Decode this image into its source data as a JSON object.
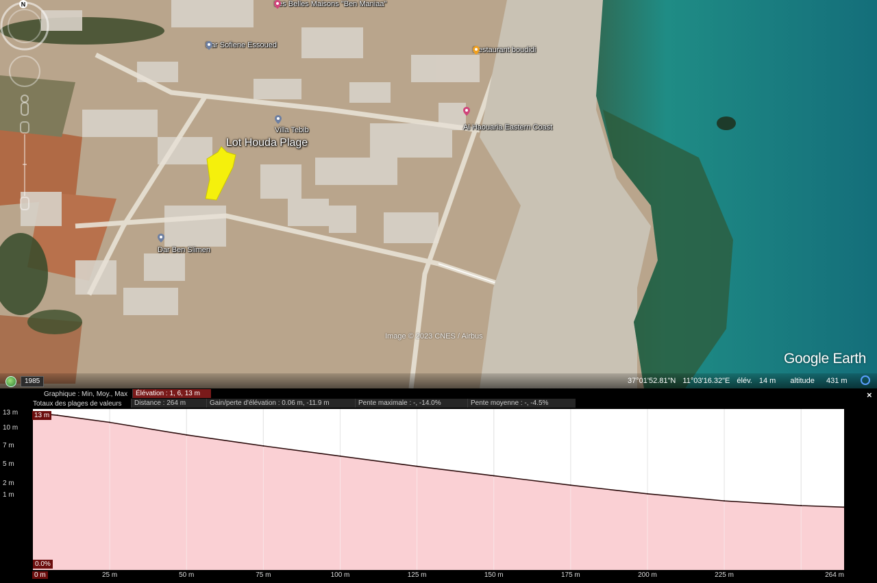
{
  "map": {
    "places": [
      {
        "name": "Les Belles Maisons \"Ben Maniaa\"",
        "pin": "pink"
      },
      {
        "name": "Dar Sofiene Essoued",
        "pin": "gray"
      },
      {
        "name": "Restaurant boudidi",
        "pin": "orange"
      },
      {
        "name": "Villa Tebib",
        "pin": "gray"
      },
      {
        "name": "Al Haouaria Eastern Coast",
        "pin": "pink"
      },
      {
        "name": "Dar Ben Slimen",
        "pin": "gray"
      }
    ],
    "lot_label": "Lot Houda Plage",
    "credit": "Image © 2023 CNES / Airbus",
    "logo": "Google Earth",
    "compass_letter": "N"
  },
  "status": {
    "year": "1985",
    "lat": "37°01'52.81\"N",
    "lon": "11°03'16.32\"E",
    "elev_label": "élév.",
    "elev_value": "14 m",
    "alt_label": "altitude",
    "alt_value": "431 m"
  },
  "profile": {
    "close": "×",
    "graph_label": "Graphique : Min, Moy., Max",
    "elevation_field": "Élévation : 1, 6, 13 m",
    "totals_label": "Totaux des plages de valeurs",
    "distance_field": "Distance : 264 m",
    "gain_field": "Gain/perte d'élévation : 0.06 m, -11.9 m",
    "max_slope_field": "Pente maximale : -, -14.0%",
    "avg_slope_field": "Pente moyenne : -, -4.5%",
    "max_badge": "13 m",
    "min_badge": "0.0%",
    "x_start": "0 m",
    "colors": {
      "fill": "#f9c8cc",
      "line": "#2a0a0a"
    }
  },
  "chart_data": {
    "type": "area",
    "title": "",
    "xlabel": "",
    "ylabel": "",
    "x": [
      0,
      8,
      25,
      50,
      75,
      100,
      125,
      150,
      175,
      200,
      225,
      250,
      264
    ],
    "y": [
      13.0,
      12.7,
      11.8,
      10.2,
      8.8,
      7.5,
      6.2,
      5.0,
      3.8,
      2.7,
      1.8,
      1.2,
      1.0
    ],
    "x_ticks": [
      "0 m",
      "25 m",
      "50 m",
      "75 m",
      "100 m",
      "125 m",
      "150 m",
      "175 m",
      "200 m",
      "225 m",
      "264 m"
    ],
    "y_ticks": [
      "13 m",
      "10 m",
      "7 m",
      "5 m",
      "2 m",
      "1 m"
    ],
    "xlim": [
      0,
      264
    ],
    "ylim": [
      -7,
      13.5
    ],
    "grid": true
  }
}
